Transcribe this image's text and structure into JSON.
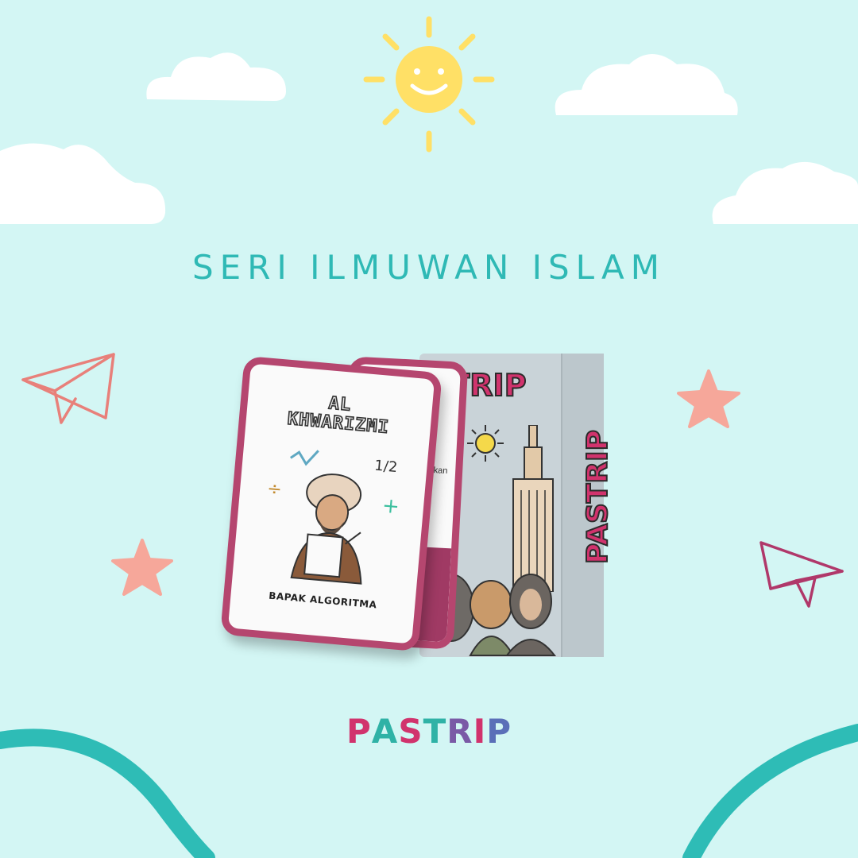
{
  "headline": "SERI ILMUWAN ISLAM",
  "brand": {
    "letters": [
      {
        "ch": "P",
        "color": "#d1336d"
      },
      {
        "ch": "A",
        "color": "#2fb2a6"
      },
      {
        "ch": "S",
        "color": "#d1336d"
      },
      {
        "ch": "T",
        "color": "#2fb2a6"
      },
      {
        "ch": "R",
        "color": "#7a5aa6"
      },
      {
        "ch": "I",
        "color": "#d1336d"
      },
      {
        "ch": "P",
        "color": "#5a6fb8"
      }
    ]
  },
  "card_front": {
    "title_line1": "AL",
    "title_line2": "KHWARIZMI",
    "caption": "BAPAK ALGORITMA",
    "fraction": "1/2"
  },
  "card_back": {
    "text": "mu akan ran."
  },
  "box": {
    "logo_visible": "STRIP",
    "side_logo": "PASTRIP"
  },
  "colors": {
    "background": "#d3f6f4",
    "accent_teal": "#2fb9b5",
    "card_border": "#b5466f",
    "sun": "#ffe066",
    "star": "#f6a79a"
  },
  "icons": [
    "sun-icon",
    "cloud-icon",
    "paper-plane-icon",
    "star-icon"
  ]
}
